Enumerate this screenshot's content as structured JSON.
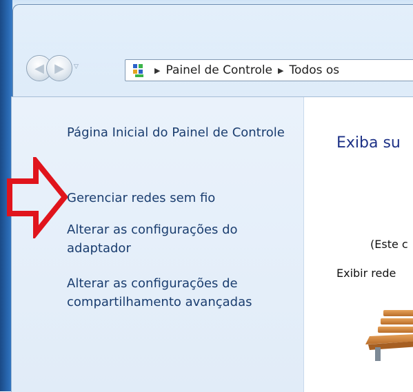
{
  "window": {
    "address_bar": {
      "crumbs": [
        "Painel de Controle",
        "Todos os"
      ]
    }
  },
  "sidebar": {
    "links": [
      {
        "label": "Página Inicial do Painel de Controle"
      },
      {
        "label": "Gerenciar redes sem fio"
      },
      {
        "label": "Alterar as configurações do adaptador"
      },
      {
        "label": "Alterar as configurações de compartilhamento avançadas"
      }
    ]
  },
  "main": {
    "title": "Exiba su",
    "text1": "(Este c",
    "text2": "Exibir rede"
  },
  "icons": {
    "back": "back-arrow-icon",
    "forward": "forward-arrow-icon",
    "control_panel": "control-panel-icon",
    "bench": "park-bench-icon",
    "annotation": "red-arrow-annotation"
  },
  "colors": {
    "link": "#1a3d6f",
    "title": "#1e3287",
    "annotation": "#e0141c"
  }
}
